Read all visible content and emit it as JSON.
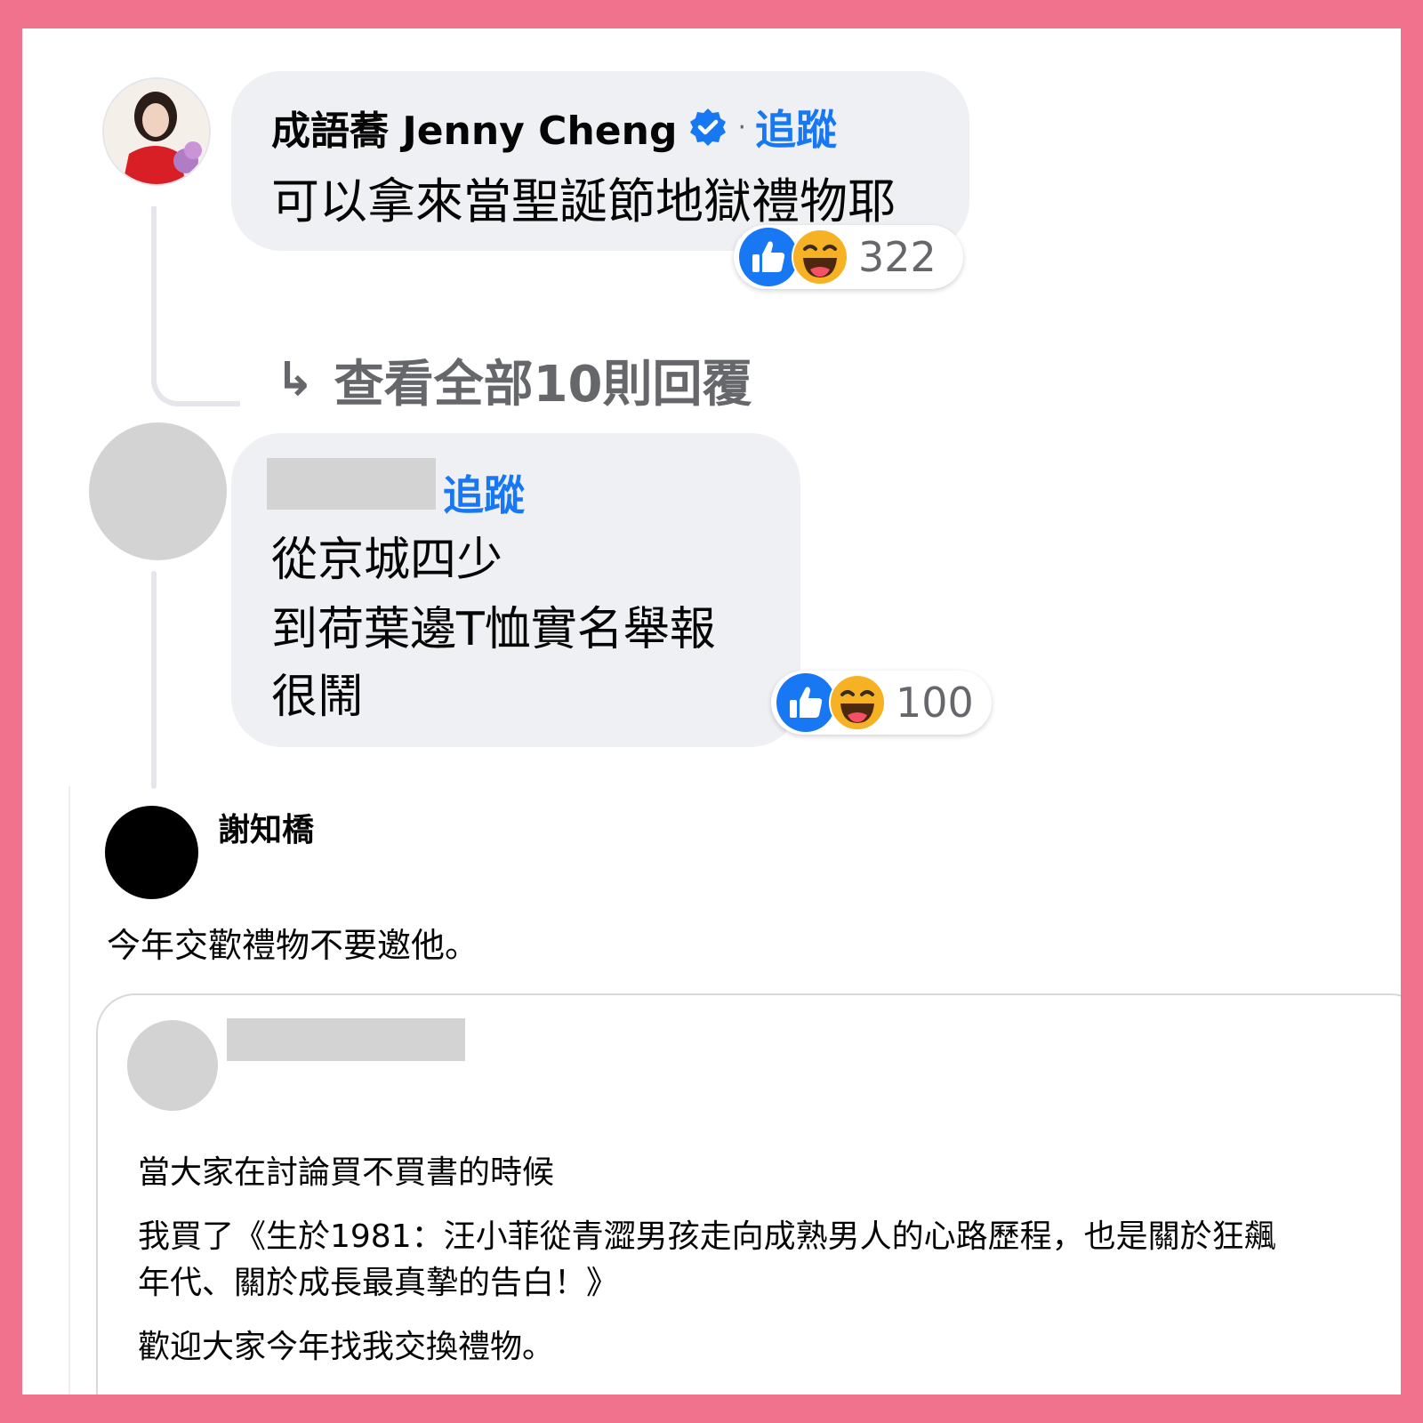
{
  "comment1": {
    "author": "成語蕎 Jenny Cheng",
    "separator": "·",
    "follow_label": "追蹤",
    "text": "可以拿來當聖誕節地獄禮物耶",
    "reaction_count": "322",
    "reaction_icons": [
      "like-icon",
      "haha-icon"
    ]
  },
  "replies": {
    "arrow": "↳",
    "label": "查看全部10則回覆"
  },
  "comment2": {
    "follow_label": "追蹤",
    "lines": [
      "從京城四少",
      "到荷葉邊T恤實名舉報",
      "很鬧"
    ],
    "reaction_count": "100",
    "reaction_icons": [
      "like-icon",
      "haha-icon"
    ]
  },
  "post": {
    "author": "謝知橋",
    "text": "今年交歡禮物不要邀他。",
    "shared": {
      "lines": [
        "當大家在討論買不買書的時候",
        "我買了《生於1981：汪小菲從青澀男孩走向成熟男人的心路歷程，也是關於狂飆",
        "年代、關於成長最真摯的告白！》",
        "歡迎大家今年找我交換禮物。"
      ]
    }
  },
  "colors": {
    "frame": "#f1728d",
    "link_blue": "#1877f2",
    "bubble": "#eef0f3",
    "muted": "#65676b"
  }
}
